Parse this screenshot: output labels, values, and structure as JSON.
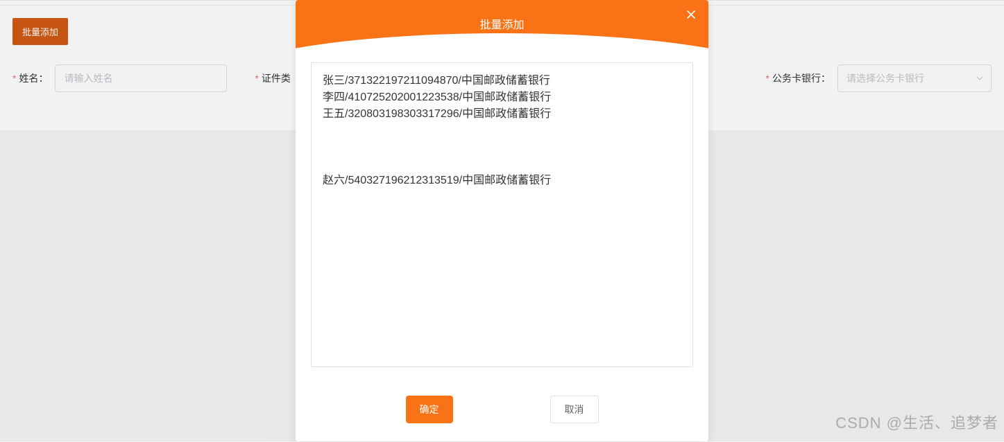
{
  "toolbar": {
    "batch_add_btn": "批量添加"
  },
  "form": {
    "name_label": "姓名：",
    "name_placeholder": "请输入姓名",
    "cert_type_label": "证件类",
    "card_bank_label": "公务卡银行：",
    "card_bank_placeholder": "请选择公务卡银行"
  },
  "modal": {
    "title": "批量添加",
    "textarea_value": "张三/371322197211094870/中国邮政储蓄银行\n李四/410725202001223538/中国邮政储蓄银行\n王五/320803198303317296/中国邮政储蓄银行\n\n\n\n赵六/540327196212313519/中国邮政储蓄银行",
    "confirm_btn": "确定",
    "cancel_btn": "取消"
  },
  "watermark": "CSDN @生活、追梦者"
}
